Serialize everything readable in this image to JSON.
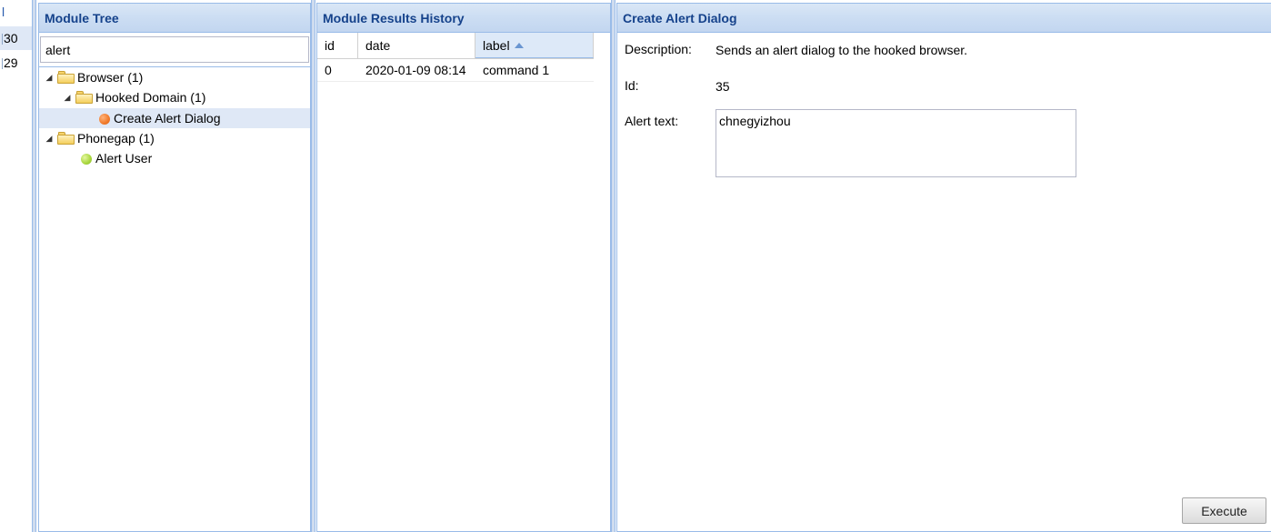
{
  "left_list": {
    "items": [
      "l",
      "30",
      "29"
    ]
  },
  "module_tree": {
    "title": "Module Tree",
    "search_value": "alert",
    "nodes": [
      {
        "label": "Browser (1)"
      },
      {
        "label": "Hooked Domain (1)"
      },
      {
        "label": "Create Alert Dialog",
        "status": "orange"
      },
      {
        "label": "Phonegap (1)"
      },
      {
        "label": "Alert User",
        "status": "green"
      }
    ]
  },
  "results_history": {
    "title": "Module Results History",
    "columns": [
      "id",
      "date",
      "label"
    ],
    "sorted_column": "label",
    "sort_direction": "ascending",
    "rows": [
      {
        "id": "0",
        "date": "2020-01-09 08:14",
        "label": "command 1"
      }
    ]
  },
  "alert_dialog": {
    "title": "Create Alert Dialog",
    "description_label": "Description:",
    "description_value": "Sends an alert dialog to the hooked browser.",
    "id_label": "Id:",
    "id_value": "35",
    "alert_text_label": "Alert text:",
    "alert_text_value": "chnegyizhou",
    "execute_label": "Execute"
  },
  "colors": {
    "header_text": "#15428b",
    "panel_border": "#99bbe8",
    "selected_row": "#dfe8f6"
  }
}
